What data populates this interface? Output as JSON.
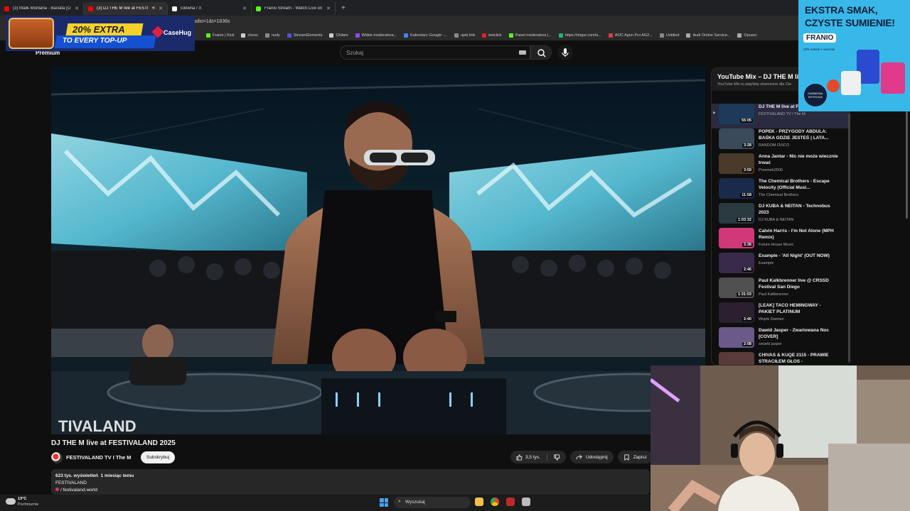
{
  "browser": {
    "tabs": [
      {
        "title": "(3) Malik Montana - Baciata [O",
        "favicon_color": "#ff0000",
        "active": false
      },
      {
        "title": "(3) DJ THE M live at FESTIVAL",
        "favicon_color": "#ff0000",
        "active": true
      },
      {
        "title": "Główna / X",
        "favicon_color": "#ffffff",
        "active": false
      },
      {
        "title": "Franio Stream - Watch Live on",
        "favicon_color": "#53fc18",
        "active": false
      }
    ],
    "new_tab": "+",
    "url_fragment": "rt_radio=1&t=1836s",
    "bookmarks": [
      {
        "label": "Franio | Kick",
        "color": "#53fc18"
      },
      {
        "label": "chess",
        "color": "#cccccc"
      },
      {
        "label": "nudy",
        "color": "#888888"
      },
      {
        "label": "StreamElements",
        "color": "#5a4fcf"
      },
      {
        "label": "Chilam",
        "color": "#cccccc"
      },
      {
        "label": "Widok moderatora...",
        "color": "#9146ff"
      },
      {
        "label": "Kalendarz Google -...",
        "color": "#4285f4"
      },
      {
        "label": "ujeb link",
        "color": "#888888"
      },
      {
        "label": "betclick",
        "color": "#e02020"
      },
      {
        "label": "Panel moderatora |...",
        "color": "#53fc18"
      },
      {
        "label": "https://imgur.com/a...",
        "color": "#1bb76e"
      },
      {
        "label": "AOC Agon Pro AG2...",
        "color": "#d04040"
      },
      {
        "label": "Untitled",
        "color": "#888888"
      },
      {
        "label": "Audi Online Service...",
        "color": "#aaaaaa"
      },
      {
        "label": "Opuszc",
        "color": "#aaaaaa"
      }
    ]
  },
  "youtube": {
    "logo_text": "Premium",
    "search_placeholder": "Szukaj"
  },
  "video": {
    "title": "DJ THE M live at FESTIVALAND 2025",
    "watermark": "TIVALAND",
    "channel": "FESTIVALAND TV I The M",
    "subscribe_label": "Subskrybuj",
    "likes": "3,5 tys.",
    "share_label": "Udostępnij",
    "save_label": "Zapisz",
    "views": "623 tys. wyświetleń",
    "age": "1 miesiąc temu",
    "desc_line1": "FESTIVALAND",
    "desc_link": "/ festivaland.world"
  },
  "playlist": {
    "title": "YouTube Mix – DJ THE M li",
    "subtitle": "YouTube Mix to playlisty stworzone dla Cie",
    "items": [
      {
        "title": "DJ THE M live at F 2025",
        "channel": "FESTIVALAND TV I The M",
        "duration": "55:05",
        "thumb": "#1d3a5a",
        "current": true
      },
      {
        "title": "POPEK - PRZYGODY ABDULA: BAŚKA GDZIE JESTEŚ | LATA...",
        "channel": "RANDOM DISCO",
        "duration": "3:28",
        "thumb": "#3a4a5a",
        "current": false
      },
      {
        "title": "Anna Jantar - Nic nie może wiecznie trwać",
        "channel": "Przemek2500",
        "duration": "3:59",
        "thumb": "#4a3a2a",
        "current": false
      },
      {
        "title": "The Chemical Brothers - Escape Velocity (Official Musi...",
        "channel": "The Chemical Brothers",
        "duration": "11:58",
        "thumb": "#1a2a4a",
        "current": false
      },
      {
        "title": "DJ KUBA & NEITAN - Technobus 2023",
        "channel": "DJ KUBA & NEITAN",
        "duration": "1:03:32",
        "thumb": "#2a3a40",
        "current": false
      },
      {
        "title": "Calvin Harris - I'm Not Alone (MPH Remix)",
        "channel": "Future House Music",
        "duration": "3:38",
        "thumb": "#d0387a",
        "current": false
      },
      {
        "title": "Example - 'All Night' (OUT NOW)",
        "channel": "Example",
        "duration": "2:46",
        "thumb": "#3a2a4a",
        "current": false
      },
      {
        "title": "Paul Kalkbrenner live @ CRSSD Festival San Diego",
        "channel": "Paul Kalkbrenner",
        "duration": "1:31:03",
        "thumb": "#505050",
        "current": false
      },
      {
        "title": "[LEAK] TACO HEMINGWAY - PAKIET PLATINUM",
        "channel": "Wujek Damian",
        "duration": "2:40",
        "thumb": "#2a2030",
        "current": false
      },
      {
        "title": "Dawid Jasper - Zwariowana Noc [COVER]",
        "channel": "smarkl jasper",
        "duration": "2:08",
        "thumb": "#6a5a8a",
        "current": false
      },
      {
        "title": "CHIVAS & KUQE 2115 - PRAWIE STRACIŁEM GŁOS -",
        "channel": "",
        "duration": "",
        "thumb": "#5a3a3a",
        "current": false
      }
    ]
  },
  "ads": {
    "case_extra": "20% EXTRA",
    "case_topup": "TO EVERY TOP-UP",
    "case_brand": "CaseHug",
    "franio_line1": "EKSTRA SMAK,",
    "franio_line2": "CZYSTE SUMIENIE!",
    "franio_logo": "FRANIO",
    "franio_small": "10% soków z owoców",
    "franio_badge": "DARMOWA WYSYŁKA!"
  },
  "taskbar": {
    "temp": "13°C",
    "weather": "Pochmurnie",
    "search_label": "Wyszukaj"
  },
  "colors": {
    "bg": "#0f0f0f",
    "accent": "#ff0000",
    "chip": "#272727"
  }
}
